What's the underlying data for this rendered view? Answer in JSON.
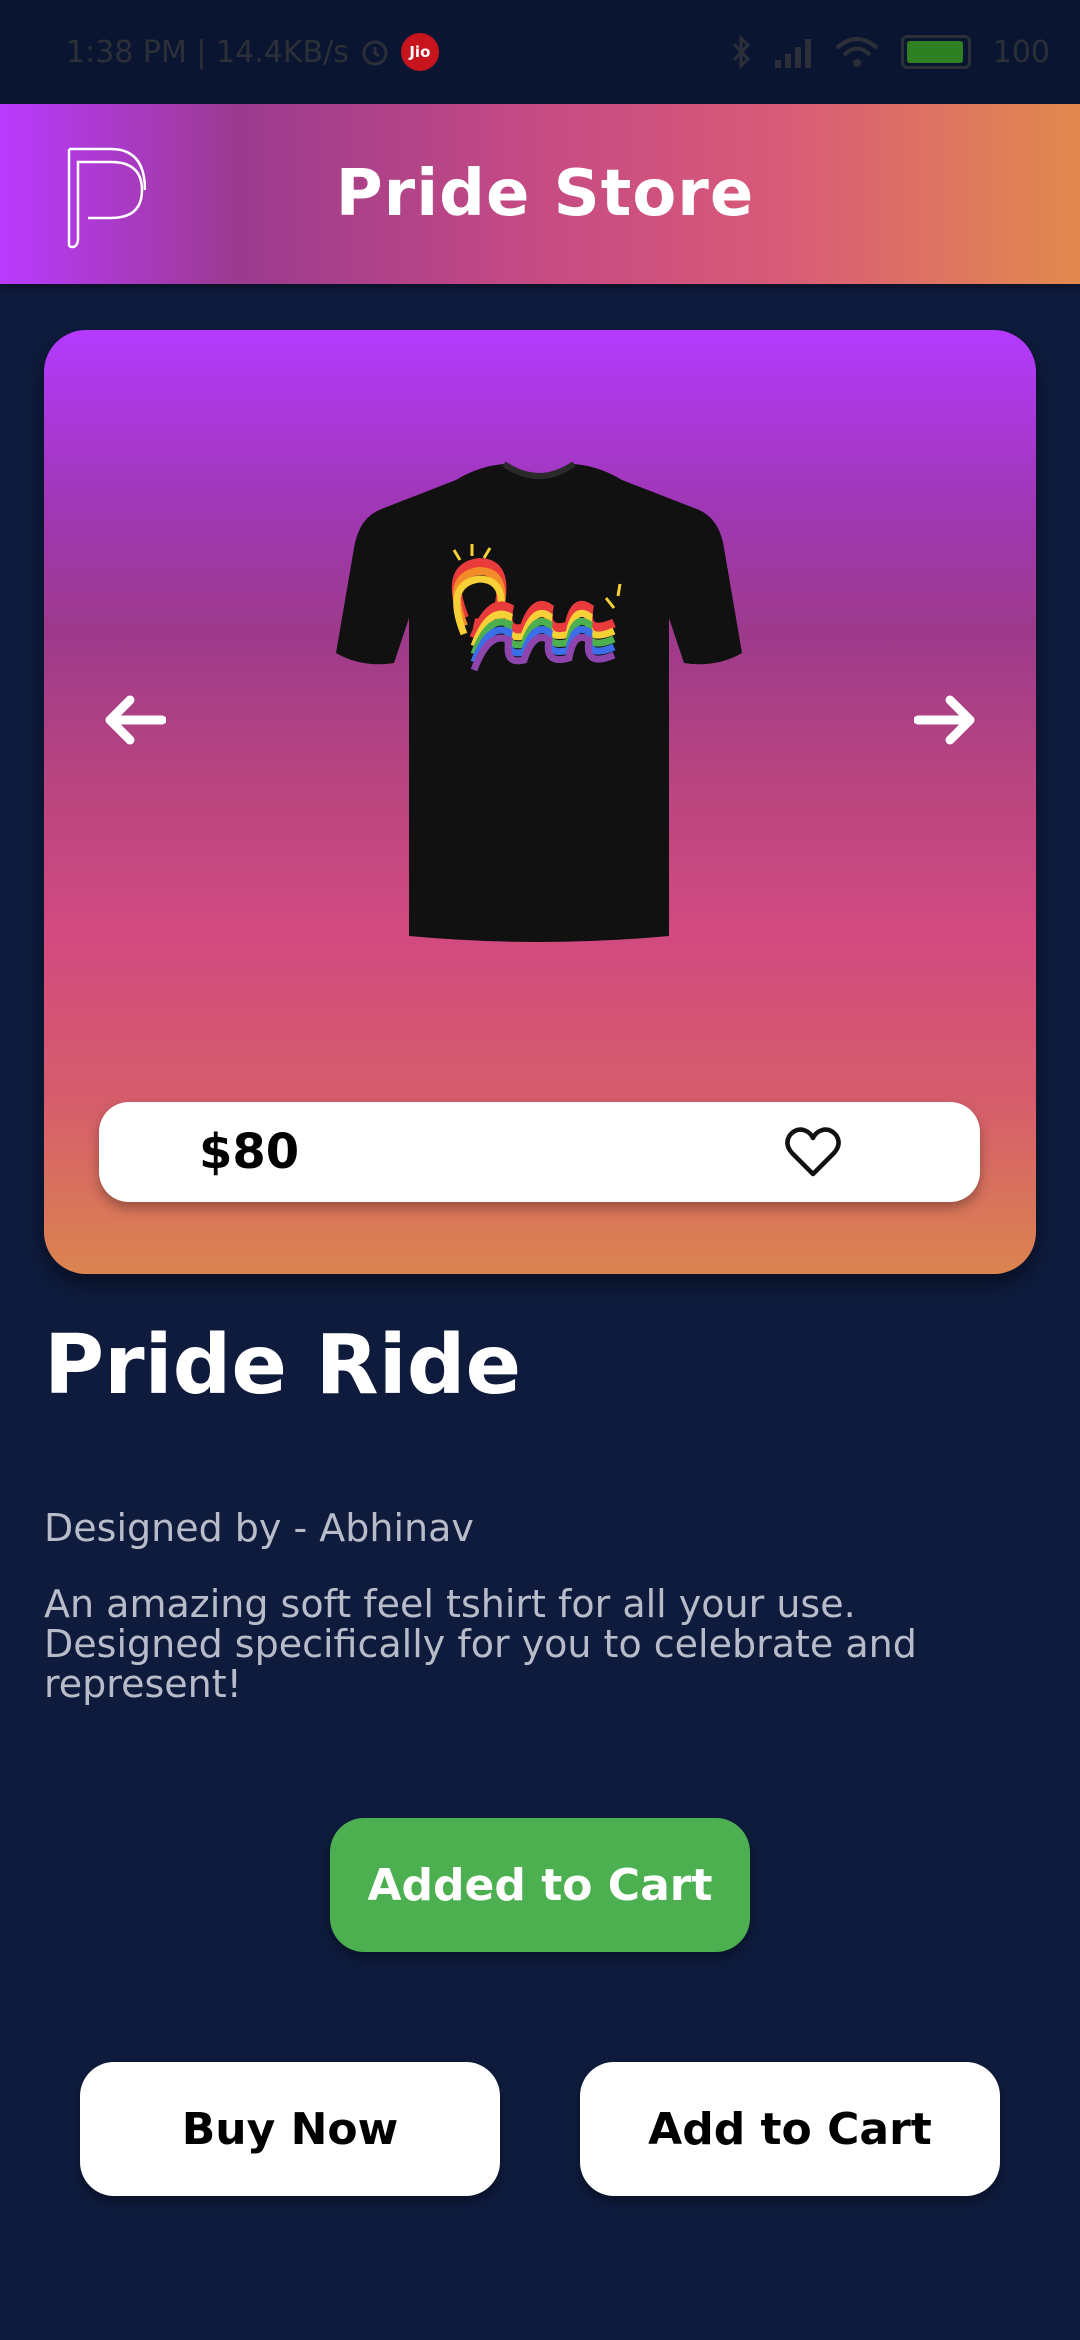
{
  "status_bar": {
    "time_speed": "1:38 PM | 14.4KB/s",
    "carrier_badge": "Jio",
    "battery": "100"
  },
  "app_bar": {
    "title": "Pride Store",
    "logo_icon": "p-logo-icon"
  },
  "product": {
    "price": "$80",
    "name": "Pride Ride",
    "designer": "Designed by - Abhinav",
    "description": "An amazing soft feel tshirt for all your use. Designed specifically for you to celebrate and represent!"
  },
  "actions": {
    "added_to_cart": "Added to Cart",
    "buy_now": "Buy Now",
    "add_to_cart": "Add to Cart"
  },
  "colors": {
    "background": "#0e1b3d",
    "gradient_start": "#b93aff",
    "gradient_end": "#e28a4e",
    "added_button": "#4caf50"
  }
}
